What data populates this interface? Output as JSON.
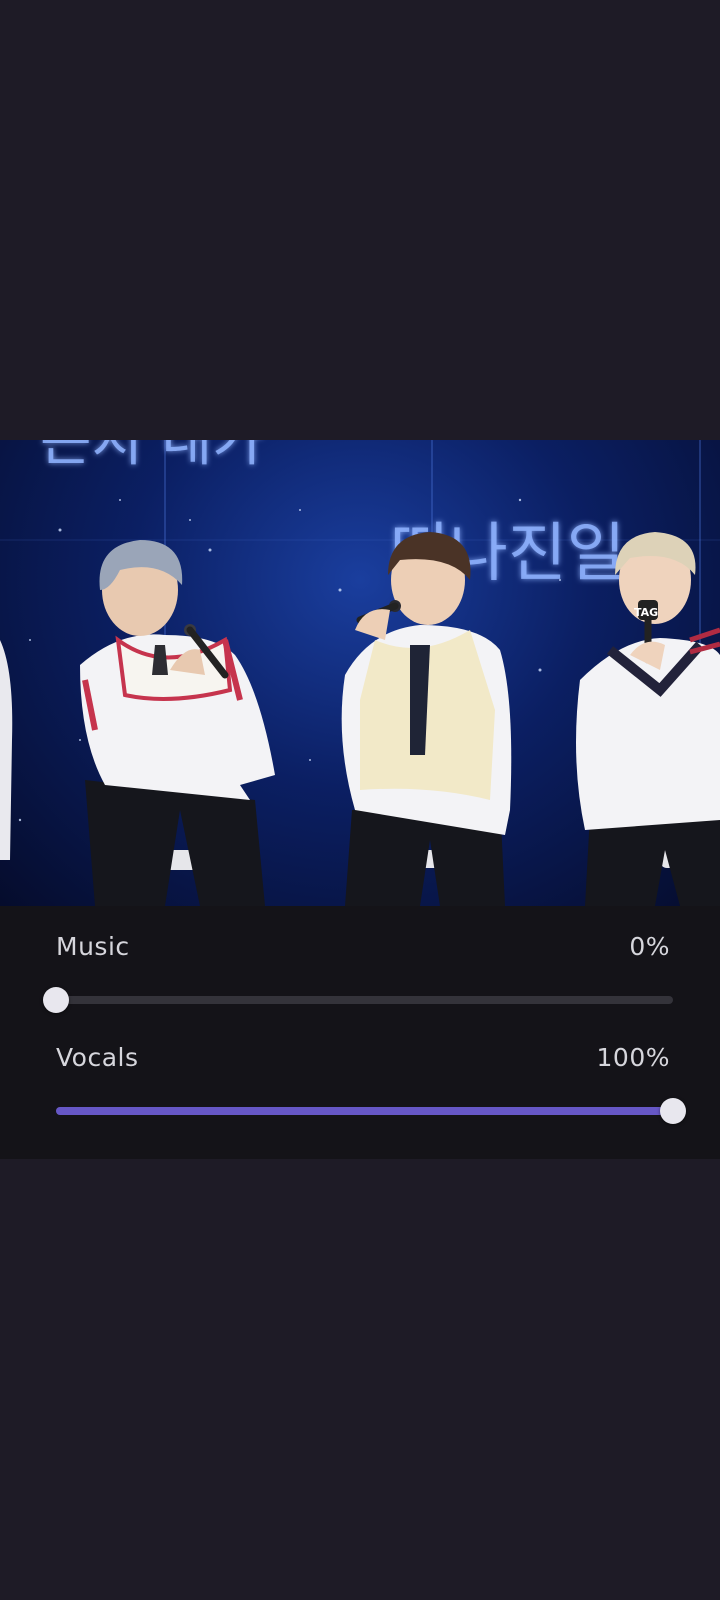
{
  "video": {
    "screen_text_top": "는지 내가",
    "screen_text_bottom": "떠나진일",
    "mic_label": "TAG"
  },
  "mixer": {
    "music": {
      "label": "Music",
      "value_text": "0%",
      "level": 0
    },
    "vocals": {
      "label": "Vocals",
      "value_text": "100%",
      "level": 1
    }
  },
  "colors": {
    "background": "#1e1b26",
    "panel": "#141318",
    "accent": "#6657c6",
    "track": "#34333a",
    "thumb": "#e8e7ee"
  }
}
